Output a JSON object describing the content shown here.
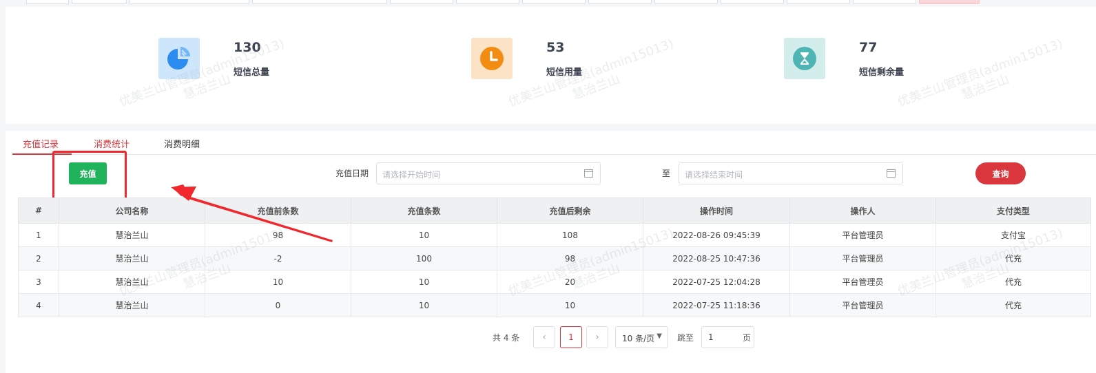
{
  "stats": [
    {
      "value": "130",
      "label": "短信总量",
      "icon": "pie-chart-icon",
      "bg": "#cde6fb",
      "color": "#2d8cf0"
    },
    {
      "value": "53",
      "label": "短信用量",
      "icon": "clock-icon",
      "bg": "#fde3c5",
      "color": "#f28c12"
    },
    {
      "value": "77",
      "label": "短信剩余量",
      "icon": "hourglass-icon",
      "bg": "#d3ecec",
      "color": "#4fb4b4"
    }
  ],
  "tabs": [
    {
      "label": "充值记录",
      "active": true
    },
    {
      "label": "消费统计",
      "active": false
    },
    {
      "label": "消费明细",
      "active": false
    }
  ],
  "toolbar": {
    "recharge_label": "充值",
    "date_label": "充值日期",
    "start_placeholder": "请选择开始时间",
    "to_label": "至",
    "end_placeholder": "请选择结束时间",
    "query_label": "查询"
  },
  "table": {
    "columns": [
      "#",
      "公司名称",
      "充值前条数",
      "充值条数",
      "充值后剩余",
      "操作时间",
      "操作人",
      "支付类型"
    ],
    "rows": [
      [
        "1",
        "慧治兰山",
        "98",
        "10",
        "108",
        "2022-08-26 09:45:39",
        "平台管理员",
        "支付宝"
      ],
      [
        "2",
        "慧治兰山",
        "-2",
        "100",
        "98",
        "2022-08-25 10:47:36",
        "平台管理员",
        "代充"
      ],
      [
        "3",
        "慧治兰山",
        "10",
        "10",
        "20",
        "2022-07-25 12:04:28",
        "平台管理员",
        "代充"
      ],
      [
        "4",
        "慧治兰山",
        "0",
        "10",
        "10",
        "2022-07-25 11:18:36",
        "平台管理员",
        "代充"
      ]
    ]
  },
  "pagination": {
    "total_text": "共 4 条",
    "current_page": "1",
    "page_size": "10 条/页",
    "jump_label": "跳至",
    "jump_value": "1",
    "page_label": "页"
  },
  "watermark": {
    "line1": "优美兰山管理员(admin15013)",
    "line2": "慧治兰山"
  },
  "colors": {
    "primary_red": "#d9363e",
    "green": "#21b35c",
    "annotation_red": "#f0282e"
  }
}
